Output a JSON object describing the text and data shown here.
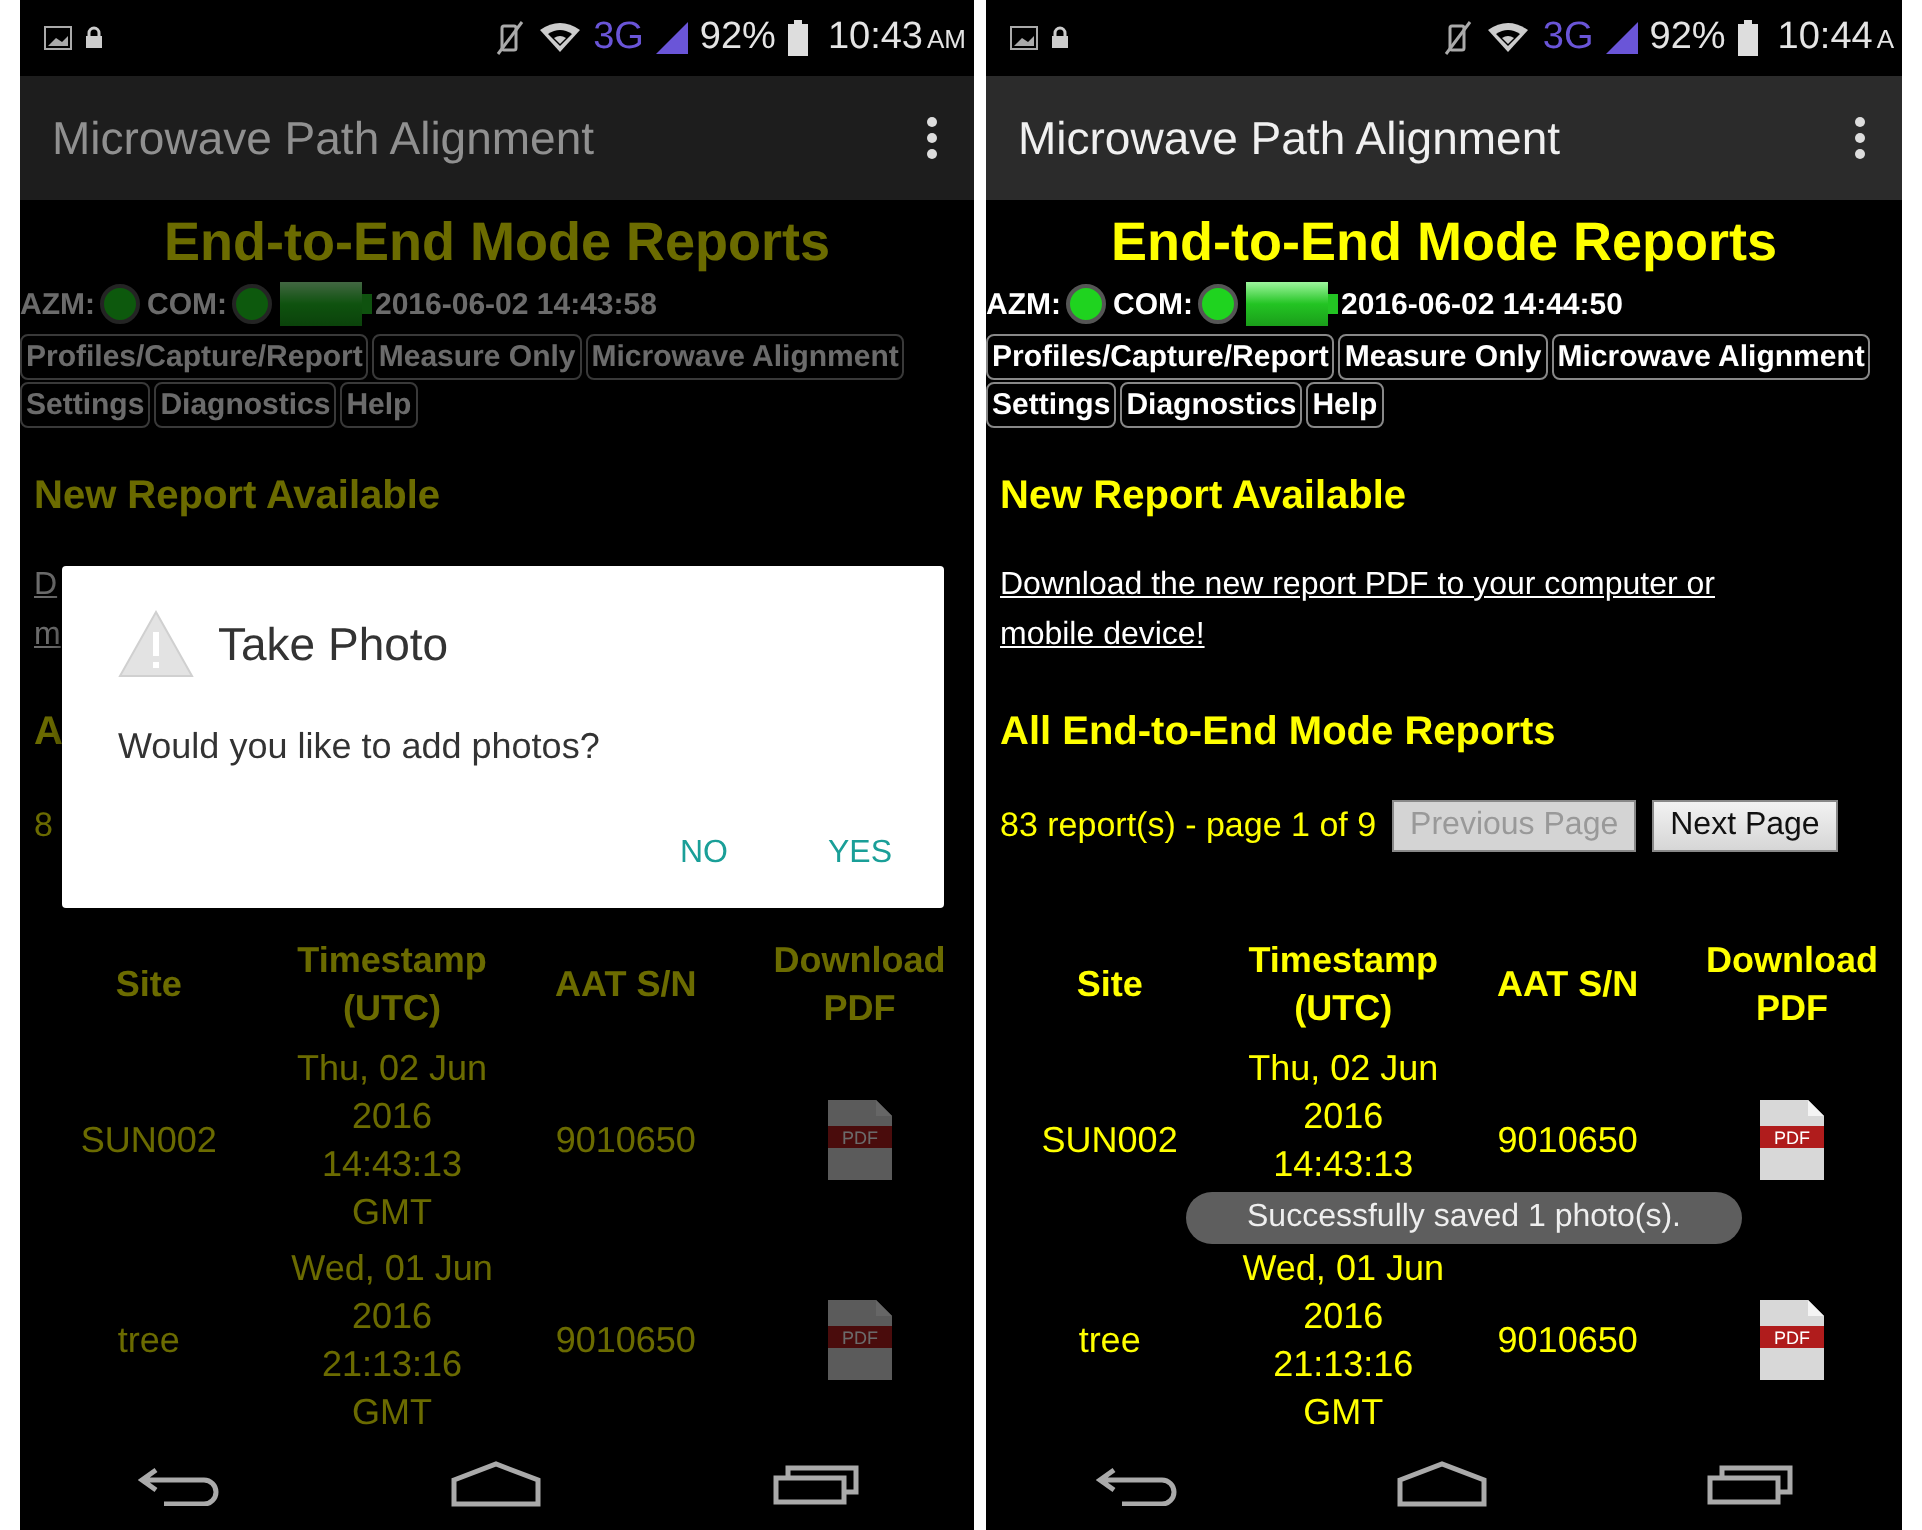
{
  "screens": [
    {
      "dimmed": true,
      "status_bar": {
        "network": "3G",
        "battery": "92%",
        "time": "10:43",
        "am_pm": "AM"
      },
      "app_bar": {
        "title": "Microwave Path Alignment"
      },
      "page": {
        "heading": "End-to-End Mode Reports",
        "azm_label": "AZM:",
        "com_label": "COM:",
        "datetime": "2016-06-02 14:43:58",
        "nav_rows": [
          {
            "buttons": [
              "Profiles/Capture/Report",
              "Measure Only",
              "Microwave Alignment"
            ]
          },
          {
            "buttons": [
              "Settings",
              "Diagnostics",
              "Help"
            ]
          }
        ],
        "new_report_heading": "New Report Available",
        "download_link": [
          "D",
          "m"
        ],
        "all_reports_heading": "A",
        "report_count": "8",
        "table": {
          "columns": [
            [
              "Site"
            ],
            [
              "Timestamp",
              "(UTC)"
            ],
            [
              "AAT S/N"
            ],
            [
              "Download",
              "PDF"
            ]
          ],
          "rows": [
            {
              "site": "SUN002",
              "timestamp": [
                "Thu, 02 Jun",
                "2016",
                "14:43:13",
                "GMT"
              ],
              "serial": "9010650",
              "file_label": "PDF"
            },
            {
              "site": "tree",
              "timestamp": [
                "Wed, 01 Jun",
                "2016",
                "21:13:16",
                "GMT"
              ],
              "serial": "9010650",
              "file_label": "PDF"
            }
          ]
        }
      },
      "dialog": {
        "title": "Take Photo",
        "message": "Would you like to add photos?",
        "buttons": [
          "NO",
          "YES"
        ]
      }
    },
    {
      "dimmed": false,
      "status_bar": {
        "network": "3G",
        "battery": "92%",
        "time": "10:44",
        "am_pm": "A"
      },
      "app_bar": {
        "title": "Microwave Path Alignment"
      },
      "page": {
        "heading": "End-to-End Mode Reports",
        "azm_label": "AZM:",
        "com_label": "COM:",
        "datetime": "2016-06-02 14:44:50",
        "nav_rows": [
          {
            "buttons": [
              "Profiles/Capture/Report",
              "Measure Only",
              "Microwave Alignment"
            ]
          },
          {
            "buttons": [
              "Settings",
              "Diagnostics",
              "Help"
            ]
          }
        ],
        "new_report_heading": "New Report Available",
        "download_link": [
          "Download the new report PDF to your computer or",
          "mobile device!"
        ],
        "all_reports_heading": "All End-to-End Mode Reports",
        "report_count": "83 report(s) - page 1 of 9",
        "pagination": [
          {
            "label": "Previous Page",
            "disabled": true
          },
          {
            "label": "Next Page",
            "disabled": false
          }
        ],
        "table": {
          "columns": [
            [
              "Site"
            ],
            [
              "Timestamp",
              "(UTC)"
            ],
            [
              "AAT S/N"
            ],
            [
              "Download",
              "PDF"
            ]
          ],
          "rows": [
            {
              "site": "SUN002",
              "timestamp": [
                "Thu, 02 Jun",
                "2016",
                "14:43:13"
              ],
              "serial": "9010650",
              "file_label": "PDF"
            },
            {
              "site": "tree",
              "timestamp": [
                "Wed, 01 Jun",
                "2016",
                "21:13:16",
                "GMT"
              ],
              "serial": "9010650",
              "file_label": "PDF"
            }
          ]
        }
      },
      "toast": {
        "text": "Successfully saved 1 photo(s)."
      }
    }
  ]
}
